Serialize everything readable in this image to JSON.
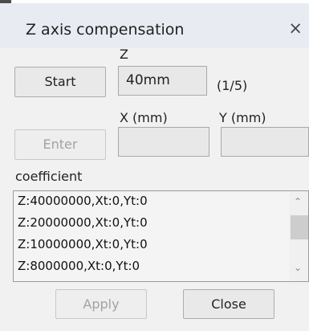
{
  "dialog": {
    "title": "Z axis compensation",
    "close_glyph": "×"
  },
  "z": {
    "label": "Z",
    "value": "40mm",
    "progress": "(1/5)"
  },
  "buttons": {
    "start": "Start",
    "enter": "Enter",
    "apply": "Apply",
    "close": "Close"
  },
  "xy": {
    "x_label": "X (mm)",
    "y_label": "Y (mm)",
    "x_value": "",
    "y_value": ""
  },
  "coefficient": {
    "label": "coefficient",
    "rows": [
      "Z:40000000,Xt:0,Yt:0",
      "Z:20000000,Xt:0,Yt:0",
      "Z:10000000,Xt:0,Yt:0",
      "Z:8000000,Xt:0,Yt:0"
    ]
  },
  "scrollbar": {
    "up_icon": "chevron-up-icon",
    "down_icon": "chevron-down-icon"
  }
}
